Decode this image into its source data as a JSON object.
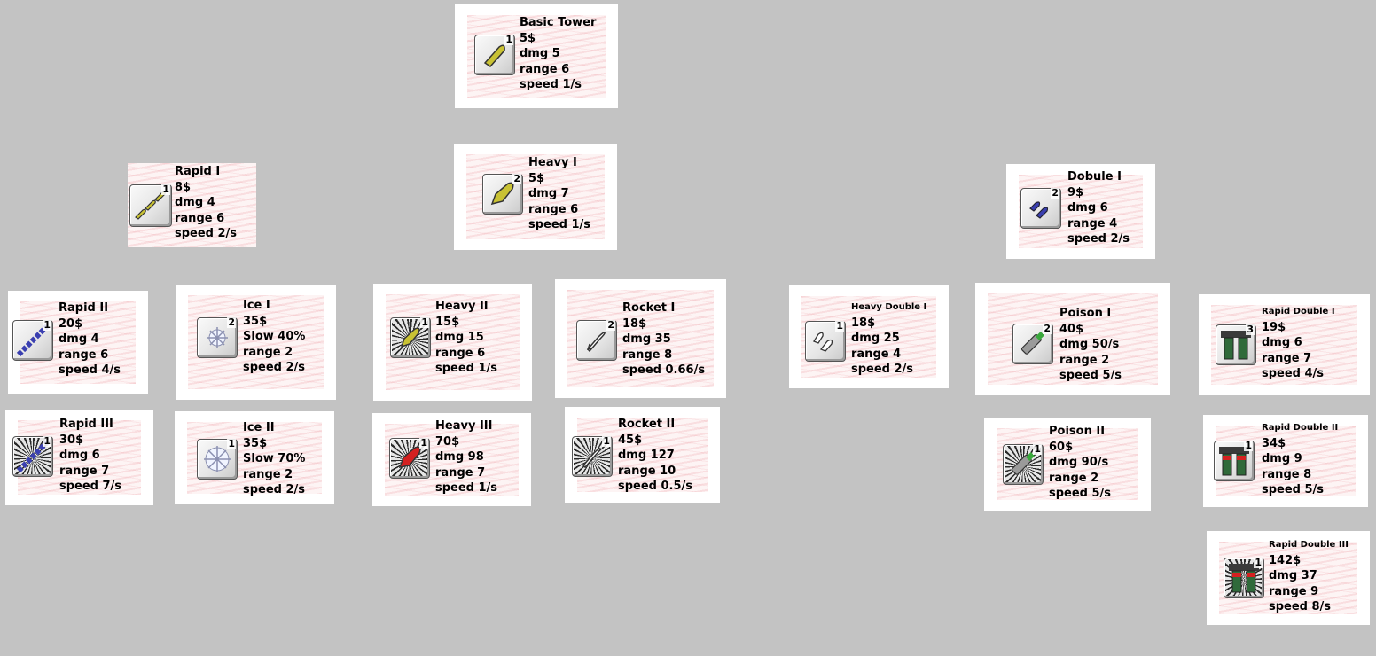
{
  "towers": {
    "basic": {
      "name": "Basic Tower",
      "cost": "5$",
      "dmg": "dmg 5",
      "range": "range 6",
      "speed": "speed 1/s",
      "level": "1",
      "icon": "basic-bullet-icon"
    },
    "rapid1": {
      "name": "Rapid I",
      "cost": "8$",
      "dmg": "dmg 4",
      "range": "range 6",
      "speed": "speed 2/s",
      "level": "1",
      "icon": "rapid-bullets-icon"
    },
    "heavy1": {
      "name": "Heavy I",
      "cost": "5$",
      "dmg": "dmg 7",
      "range": "range 6",
      "speed": "speed 1/s",
      "level": "2",
      "icon": "heavy-bullet-icon"
    },
    "double1": {
      "name": "Dobule I",
      "cost": "9$",
      "dmg": "dmg 6",
      "range": "range 4",
      "speed": "speed 2/s",
      "level": "2",
      "icon": "double-bullets-icon"
    },
    "rapid2": {
      "name": "Rapid II",
      "cost": "20$",
      "dmg": "dmg 4",
      "range": "range 6",
      "speed": "speed 4/s",
      "level": "1",
      "icon": "rapid-chain-icon"
    },
    "ice1": {
      "name": "Ice I",
      "cost": "35$",
      "dmg": "Slow 40%",
      "range": "range 2",
      "speed": "speed 2/s",
      "level": "2",
      "icon": "snowflake-icon"
    },
    "heavy2": {
      "name": "Heavy II",
      "cost": "15$",
      "dmg": "dmg 15",
      "range": "range 6",
      "speed": "speed 1/s",
      "level": "1",
      "icon": "heavy-bullet-burst-icon"
    },
    "rocket1": {
      "name": "Rocket I",
      "cost": "18$",
      "dmg": "dmg 35",
      "range": "range 8",
      "speed": "speed 0.66/s",
      "level": "2",
      "icon": "rocket-icon"
    },
    "heavydouble1": {
      "name": "Heavy Double I",
      "cost": "18$",
      "dmg": "dmg 25",
      "range": "range 4",
      "speed": "speed 2/s",
      "level": "1",
      "icon": "heavy-double-bullets-icon"
    },
    "poison1": {
      "name": "Poison I",
      "cost": "40$",
      "dmg": "dmg 50/s",
      "range": "range 2",
      "speed": "speed 5/s",
      "level": "2",
      "icon": "poison-canister-icon"
    },
    "rapiddouble1": {
      "name": "Rapid Double I",
      "cost": "19$",
      "dmg": "dmg 6",
      "range": "range 7",
      "speed": "speed 4/s",
      "level": "3",
      "icon": "twin-barrel-icon"
    },
    "rapid3": {
      "name": "Rapid III",
      "cost": "30$",
      "dmg": "dmg 6",
      "range": "range 7",
      "speed": "speed 7/s",
      "level": "1",
      "icon": "rapid-chain-burst-icon"
    },
    "ice2": {
      "name": "Ice II",
      "cost": "35$",
      "dmg": "Slow 70%",
      "range": "range 2",
      "speed": "speed 2/s",
      "level": "1",
      "icon": "snowflake-large-icon"
    },
    "heavy3": {
      "name": "Heavy III",
      "cost": "70$",
      "dmg": "dmg 98",
      "range": "range 7",
      "speed": "speed 1/s",
      "level": "1",
      "icon": "red-heavy-bullet-burst-icon"
    },
    "rocket2": {
      "name": "Rocket II",
      "cost": "45$",
      "dmg": "dmg 127",
      "range": "range 10",
      "speed": "speed 0.5/s",
      "level": "1",
      "icon": "rocket-burst-icon"
    },
    "poison2": {
      "name": "Poison II",
      "cost": "60$",
      "dmg": "dmg 90/s",
      "range": "range 2",
      "speed": "speed 5/s",
      "level": "1",
      "icon": "poison-canister-burst-icon"
    },
    "rapiddouble2": {
      "name": "Rapid Double II",
      "cost": "34$",
      "dmg": "dmg 9",
      "range": "range 8",
      "speed": "speed 5/s",
      "level": "1",
      "icon": "twin-barrel-red-icon"
    },
    "rapiddouble3": {
      "name": "Rapid Double III",
      "cost": "142$",
      "dmg": "dmg 37",
      "range": "range 9",
      "speed": "speed 8/s",
      "level": "1",
      "icon": "twin-barrel-red-burst-icon"
    }
  },
  "colors": {
    "background": "#c3c3c3",
    "card": "#ffffff",
    "bullet_yellow": "#c9c234",
    "rapid_blue": "#3a3fb0",
    "poison_green": "#39a83c",
    "heavy_red": "#d42020",
    "ice_white": "#f0f4ff"
  }
}
